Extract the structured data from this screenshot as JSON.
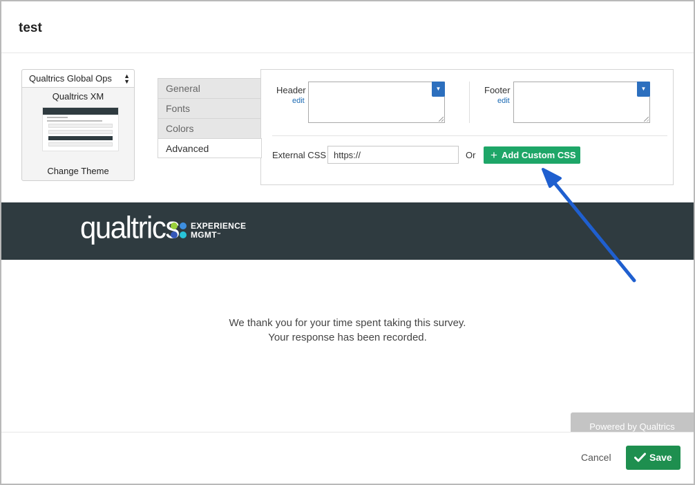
{
  "dialog": {
    "title": "test"
  },
  "theme": {
    "library_selected": "Qualtrics Global Ops",
    "name": "Qualtrics XM",
    "change_label": "Change Theme"
  },
  "tabs": [
    {
      "label": "General",
      "active": false
    },
    {
      "label": "Fonts",
      "active": false
    },
    {
      "label": "Colors",
      "active": false
    },
    {
      "label": "Advanced",
      "active": true
    }
  ],
  "advanced": {
    "header_label": "Header",
    "header_edit": "edit",
    "footer_label": "Footer",
    "footer_edit": "edit",
    "external_css_label": "External CSS",
    "external_css_value": "https://",
    "or_label": "Or",
    "add_custom_css_label": "Add Custom CSS"
  },
  "preview": {
    "logo_text": "qualtrics",
    "logo_tag_line1": "EXPERIENCE",
    "logo_tag_line2": "MGMT",
    "logo_tm": "™",
    "thank_you_line1": "We thank you for your time spent taking this survey.",
    "thank_you_line2": "Your response has been recorded.",
    "powered_by": "Powered by Qualtrics"
  },
  "footer": {
    "cancel_label": "Cancel",
    "save_label": "Save"
  },
  "colors": {
    "add_css_green": "#1ea668",
    "save_green": "#1e8f4f",
    "dropdown_blue": "#2c6fbe",
    "banner_dark": "#2f3b40",
    "annotation_arrow": "#1f5fcf"
  },
  "icons": {
    "select_arrows": "up-down-arrows-icon",
    "dropdown": "caret-down-icon",
    "plus": "plus-icon",
    "save": "checkmark-icon"
  }
}
